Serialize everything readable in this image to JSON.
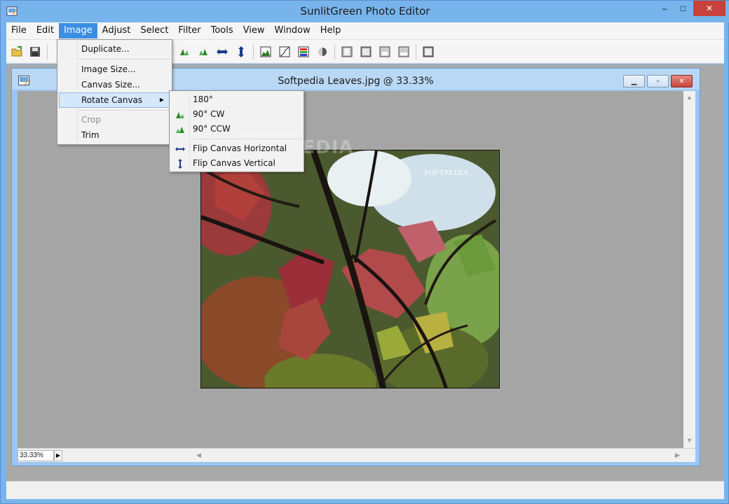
{
  "window": {
    "title": "SunlitGreen Photo Editor",
    "minimize": "–",
    "maximize": "□",
    "close": "✕"
  },
  "menubar": {
    "items": [
      "File",
      "Edit",
      "Image",
      "Adjust",
      "Select",
      "Filter",
      "Tools",
      "View",
      "Window",
      "Help"
    ],
    "active": "Image"
  },
  "toolbar": {
    "icons": [
      "open-folder-icon",
      "save-icon",
      "rotate-180-icon",
      "rotate-90cw-icon",
      "rotate-90ccw-icon",
      "flip-horizontal-icon",
      "flip-vertical-icon",
      "histogram-icon",
      "curves-icon",
      "color-balance-icon",
      "contrast-icon",
      "frame-1-icon",
      "frame-2-icon",
      "frame-3-icon",
      "frame-4-icon",
      "fullscreen-icon"
    ]
  },
  "image_menu": {
    "items": [
      {
        "label": "Duplicate...",
        "enabled": true
      },
      {
        "label": "Image Size...",
        "enabled": true
      },
      {
        "label": "Canvas Size...",
        "enabled": true
      },
      {
        "label": "Rotate Canvas",
        "enabled": true,
        "submenu": true,
        "highlighted": true
      },
      {
        "label": "Crop",
        "enabled": false
      },
      {
        "label": "Trim",
        "enabled": true
      }
    ],
    "submenu_arrow": "▶"
  },
  "rotate_submenu": {
    "items": [
      {
        "label": "180°",
        "icon": ""
      },
      {
        "label": "90° CW",
        "icon": "rotate-cw-icon"
      },
      {
        "label": "90° CCW",
        "icon": "rotate-ccw-icon"
      },
      {
        "label": "Flip Canvas Horizontal",
        "icon": "flip-horizontal-icon"
      },
      {
        "label": "Flip Canvas Vertical",
        "icon": "flip-vertical-icon"
      }
    ]
  },
  "document": {
    "title": "Softpedia Leaves.jpg @ 33.33%",
    "zoom": "33.33%",
    "watermark": "SOFTPEDIA",
    "ghost_watermark": "SOFTPEDIA"
  },
  "colors": {
    "titlebar": "#78b4ec",
    "menu_active": "#3a8ee6",
    "menu_highlight": "#d5e8fb",
    "close_button": "#c8413a",
    "workspace": "#a9a9a9"
  }
}
